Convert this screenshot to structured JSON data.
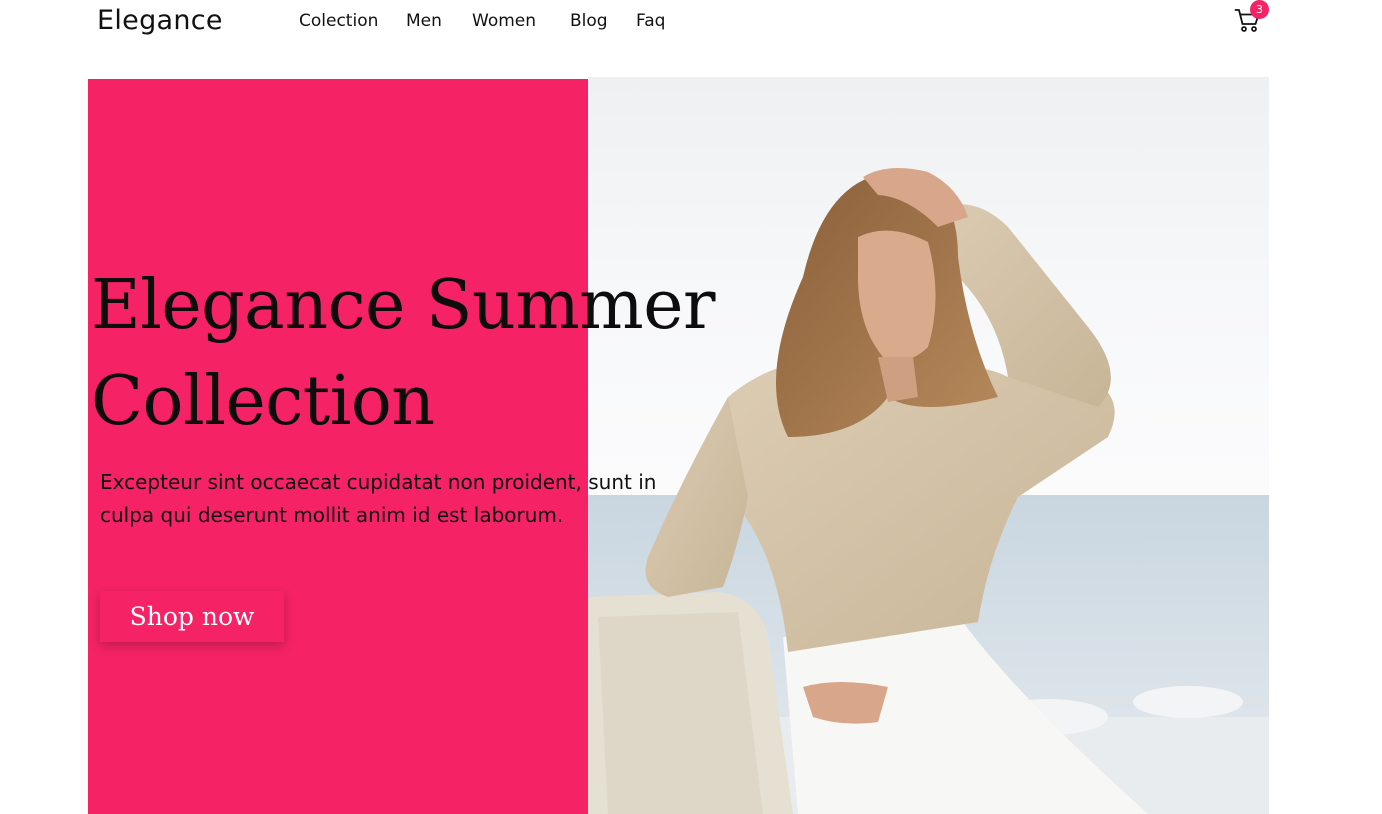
{
  "brand": {
    "name": "Elegance",
    "accent_color": "#f52265"
  },
  "nav": {
    "items": [
      {
        "label": "Colection"
      },
      {
        "label": "Men"
      },
      {
        "label": "Women"
      },
      {
        "label": "Blog"
      },
      {
        "label": "Faq"
      }
    ]
  },
  "cart": {
    "icon": "cart-icon",
    "count": "3"
  },
  "hero": {
    "title_line1": "Elegance Summer",
    "title_line2": "Collection",
    "text_line1": "Excepteur sint occaecat cupidatat non proident, sunt in",
    "text_line2": "culpa qui deserunt mollit anim id est laborum.",
    "cta_label": "Shop now",
    "image_subject": "woman in beige wrap blouse and white trousers on a sunny beach"
  }
}
